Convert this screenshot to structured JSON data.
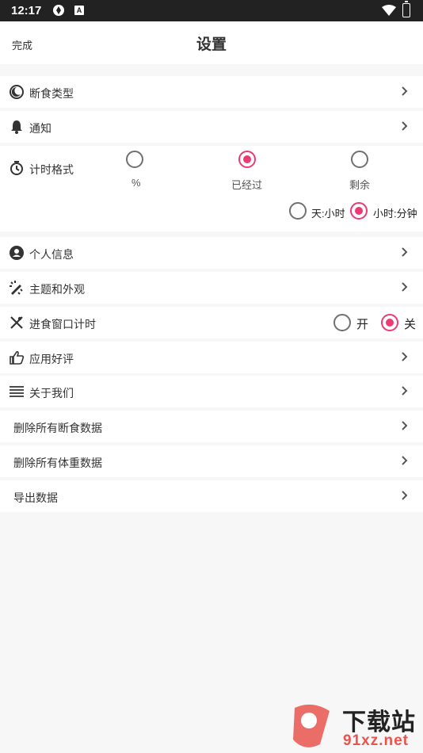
{
  "status_bar": {
    "time": "12:17",
    "notif_icon": "A"
  },
  "header": {
    "done": "完成",
    "title": "设置"
  },
  "rows": {
    "fasting_type": "断食类型",
    "notifications": "通知",
    "timer_format": "计时格式",
    "personal_info": "个人信息",
    "theme": "主题和外观",
    "eating_window": "进食窗口计时",
    "rate_app": "应用好评",
    "about": "关于我们",
    "delete_fasting": "删除所有断食数据",
    "delete_weight": "删除所有体重数据",
    "export": "导出数据"
  },
  "timer_format": {
    "options": [
      "%",
      "已经过",
      "剩余"
    ],
    "selected": "已经过",
    "unit_options": [
      "天:小时",
      "小时:分钟"
    ],
    "unit_selected": "小时:分钟"
  },
  "eating_window": {
    "on_label": "开",
    "off_label": "关",
    "selected": "关"
  },
  "watermark": {
    "line1": "下载站",
    "line2": "91xz.net"
  },
  "colors": {
    "accent": "#ee3a74",
    "background": "#f7f7f7"
  }
}
